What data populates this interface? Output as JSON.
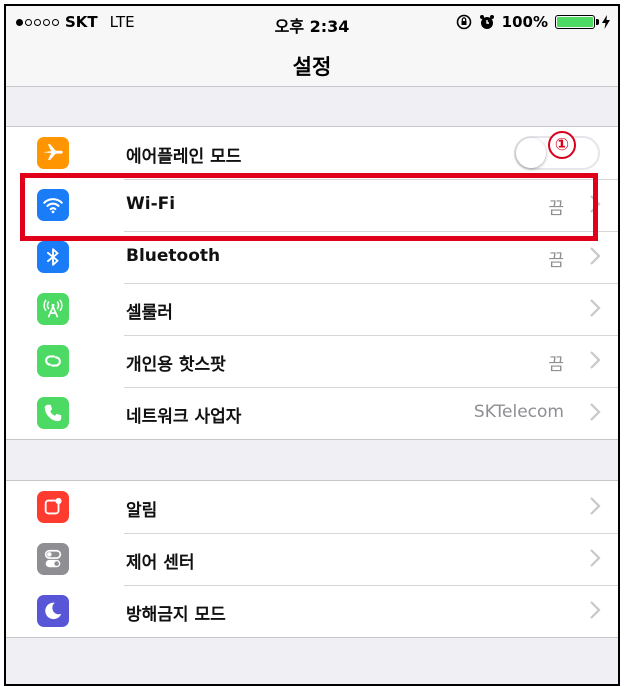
{
  "status_bar": {
    "carrier": "SKT",
    "network": "LTE",
    "time": "오후 2:34",
    "battery_text": "100%",
    "battery_level_percent": 100,
    "icons": [
      "signal-dots-icon",
      "orientation-lock-icon",
      "alarm-icon",
      "battery-icon",
      "charging-icon"
    ]
  },
  "nav": {
    "title": "설정"
  },
  "groups": [
    {
      "rows": [
        {
          "label": "에어플레인 모드",
          "control": "toggle",
          "toggle_on": false,
          "icon": "airplane-icon",
          "color": "#ff9500"
        },
        {
          "label": "Wi-Fi",
          "value": "끔",
          "icon": "wifi-icon",
          "color": "#1a7cf6"
        },
        {
          "label": "Bluetooth",
          "value": "끔",
          "icon": "bluetooth-icon",
          "color": "#1a7cf6"
        },
        {
          "label": "셀룰러",
          "value": "",
          "icon": "cellular-icon",
          "color": "#4cd964"
        },
        {
          "label": "개인용 핫스팟",
          "value": "끔",
          "icon": "hotspot-icon",
          "color": "#4cd964"
        },
        {
          "label": "네트워크 사업자",
          "value": "SKTelecom",
          "icon": "phone-icon",
          "color": "#4cd964"
        }
      ]
    },
    {
      "rows": [
        {
          "label": "알림",
          "icon": "notifications-icon",
          "color": "#ff3b30"
        },
        {
          "label": "제어 센터",
          "icon": "control-center-icon",
          "color": "#8e8e93"
        },
        {
          "label": "방해금지 모드",
          "icon": "do-not-disturb-icon",
          "color": "#5856d6"
        }
      ]
    }
  ],
  "annotation": {
    "marker": "①",
    "highlight_color": "#e00019"
  }
}
